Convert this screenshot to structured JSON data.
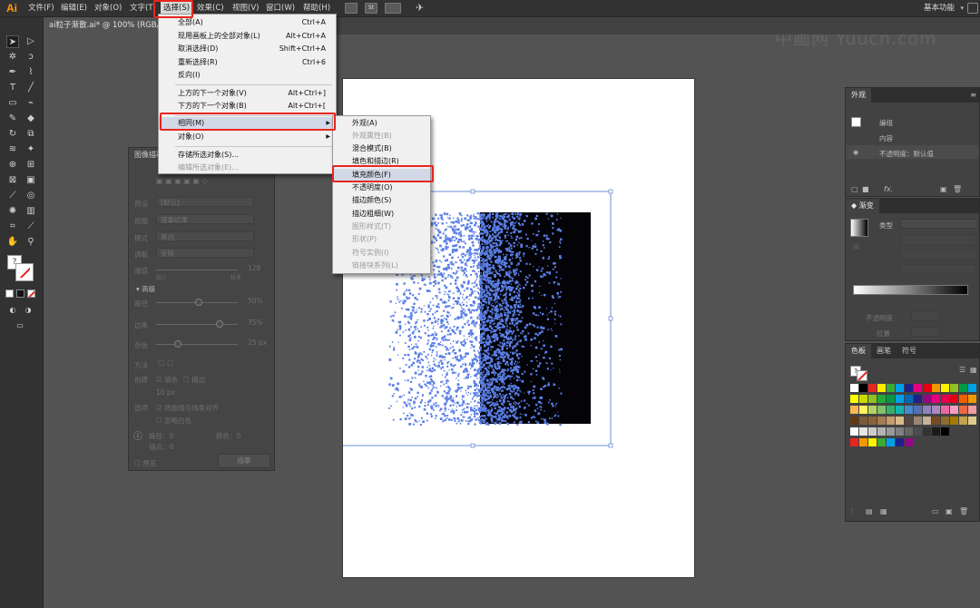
{
  "app": {
    "logo": "Ai",
    "workspace": "基本功能",
    "watermark": "中画网 Yuucn.com"
  },
  "menubar": {
    "items": [
      "文件(F)",
      "编辑(E)",
      "对象(O)",
      "文字(T)",
      "选择(S)",
      "效果(C)",
      "视图(V)",
      "窗口(W)",
      "帮助(H)"
    ]
  },
  "document": {
    "tab_title": "ai粒子渐散.ai* @ 100% (RGB/GP"
  },
  "select_menu": {
    "items": [
      {
        "label": "全部(A)",
        "shortcut": "Ctrl+A"
      },
      {
        "label": "现用画板上的全部对象(L)",
        "shortcut": "Alt+Ctrl+A"
      },
      {
        "label": "取消选择(D)",
        "shortcut": "Shift+Ctrl+A"
      },
      {
        "label": "重新选择(R)",
        "shortcut": "Ctrl+6"
      },
      {
        "label": "反向(I)",
        "shortcut": ""
      },
      {
        "label": "上方的下一个对象(V)",
        "shortcut": "Alt+Ctrl+]"
      },
      {
        "label": "下方的下一个对象(B)",
        "shortcut": "Alt+Ctrl+["
      },
      {
        "label": "相同(M)",
        "shortcut": ""
      },
      {
        "label": "对象(O)",
        "shortcut": ""
      },
      {
        "label": "存储所选对象(S)...",
        "shortcut": ""
      },
      {
        "label": "编辑所选对象(E)...",
        "shortcut": ""
      }
    ]
  },
  "same_submenu": {
    "items": [
      {
        "label": "外观(A)"
      },
      {
        "label": "外观属性(B)"
      },
      {
        "label": "混合模式(B)"
      },
      {
        "label": "填色和描边(R)"
      },
      {
        "label": "填充颜色(F)"
      },
      {
        "label": "不透明度(O)"
      },
      {
        "label": "描边颜色(S)"
      },
      {
        "label": "描边粗细(W)"
      },
      {
        "label": "图形样式(T)"
      },
      {
        "label": "形状(P)"
      },
      {
        "label": "符号实例(I)"
      },
      {
        "label": "链接块系列(L)"
      }
    ]
  },
  "image_trace_panel": {
    "title": "图像描摹",
    "fields": {
      "preset": "预设",
      "preset_value": "[默认]",
      "view": "视图",
      "view_value": "描摹结果",
      "mode": "模式",
      "mode_value": "黑白",
      "palette": "调板",
      "palette_value": "受限",
      "threshold": "阈值",
      "threshold_value": "128",
      "less": "较少",
      "more": "较多",
      "advanced": "高级",
      "paths": "路径",
      "paths_value": "50%",
      "corners": "边角",
      "corners_value": "75%",
      "noise": "杂色",
      "noise_value": "25 px",
      "method": "方法",
      "create": "创建",
      "fill": "填色",
      "stroke": "描边",
      "stroke_px": "10 px",
      "options": "选项",
      "opt1": "将曲线与线条对齐",
      "opt2": "忽略白色",
      "paths_count": "路径：0",
      "colors_count": "颜色：0",
      "anchors_count": "锚点：0",
      "preview": "预览",
      "trace_button": "描摹"
    }
  },
  "appearance_panel": {
    "title": "外观",
    "group": "编组",
    "content": "内容",
    "opacity": "不透明度：默认值"
  },
  "gradient_panel": {
    "title": "渐变",
    "type": "类型",
    "opacity_label": "不透明度",
    "position_label": "位置"
  },
  "swatches_panel": {
    "tabs": [
      "色板",
      "画笔",
      "符号"
    ]
  },
  "colors": {
    "accent_red": "#e8251f",
    "particle_blue": "#5b7fe6",
    "selection_blue": "#6b8fd6"
  }
}
